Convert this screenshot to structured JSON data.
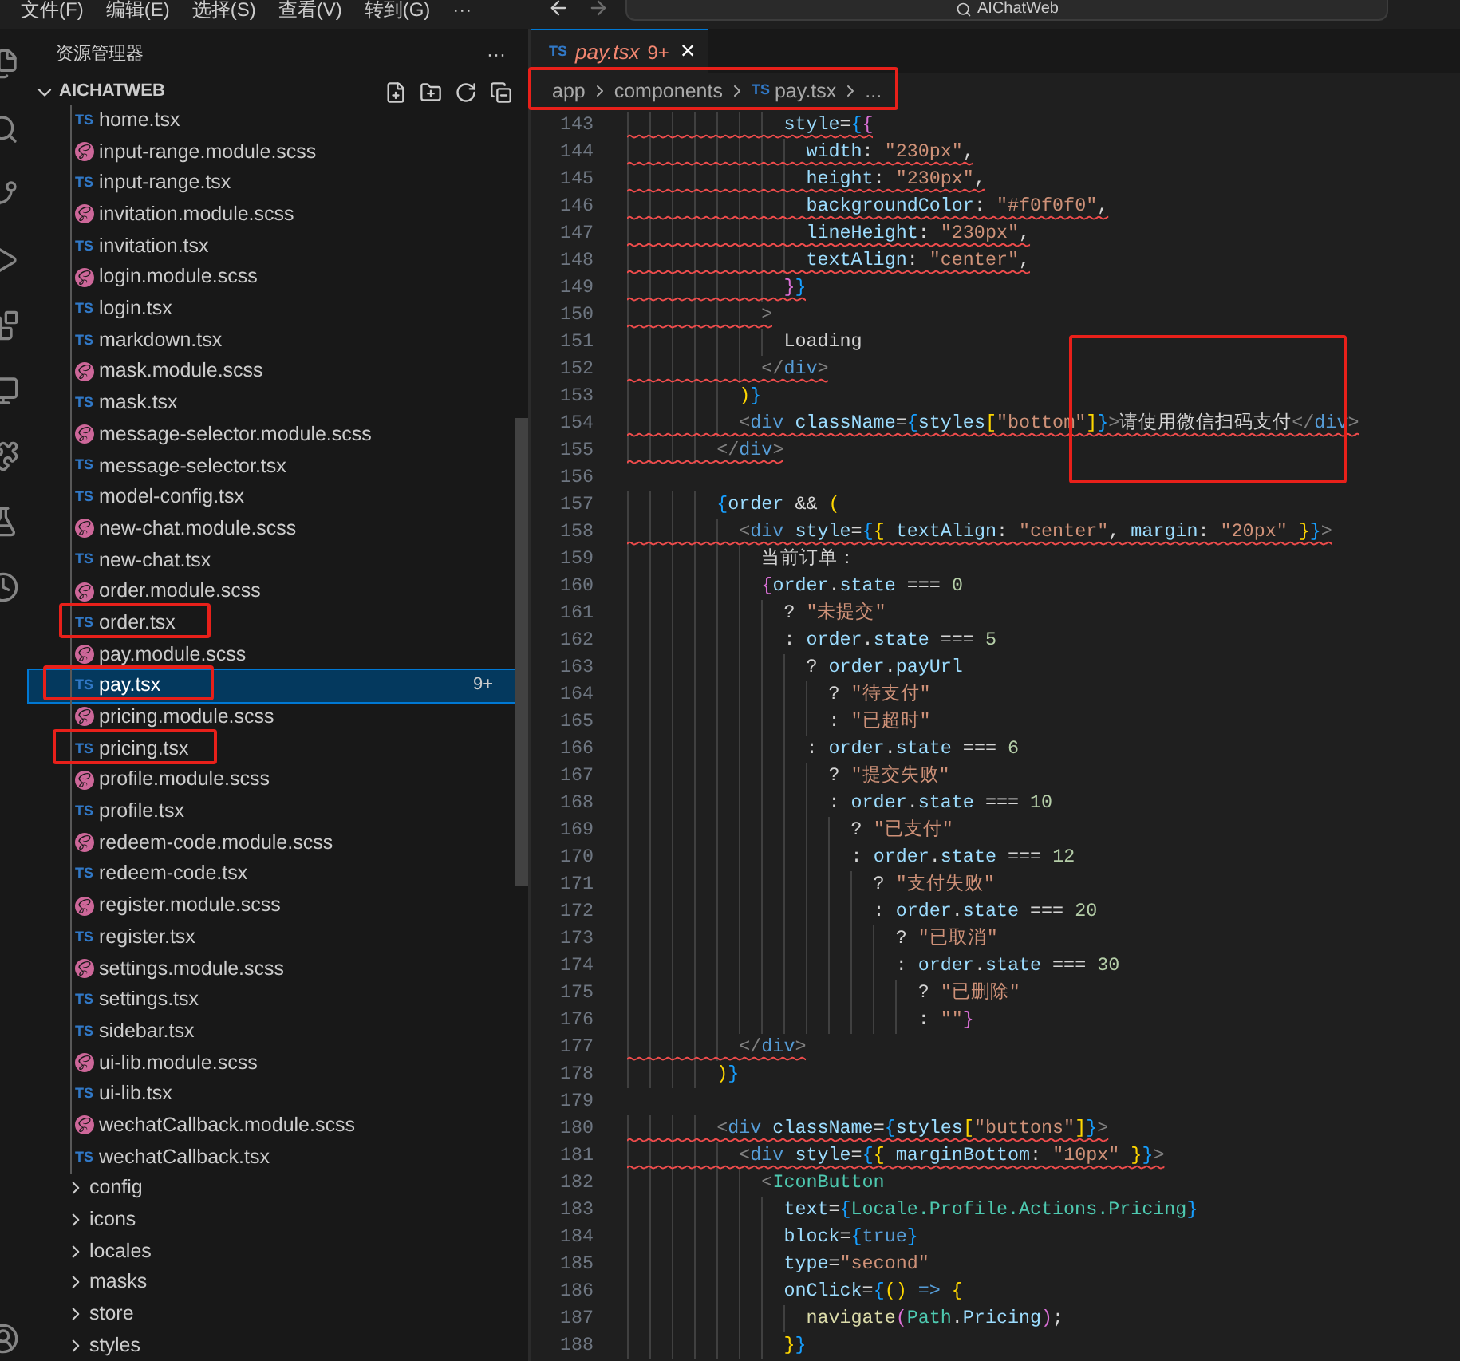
{
  "menu": [
    "文件(F)",
    "编辑(E)",
    "选择(S)",
    "查看(V)",
    "转到(G)",
    "···"
  ],
  "search": {
    "value": "AIChatWeb"
  },
  "explorer": {
    "title": "资源管理器",
    "more": "···",
    "root": "AICHATWEB",
    "expanded": true,
    "items": [
      {
        "kind": "ts",
        "icon": "TS",
        "name": "home.tsx",
        "selected": false
      },
      {
        "kind": "scss",
        "name": "input-range.module.scss",
        "selected": false
      },
      {
        "kind": "ts",
        "icon": "TS",
        "name": "input-range.tsx",
        "selected": false
      },
      {
        "kind": "scss",
        "name": "invitation.module.scss",
        "selected": false
      },
      {
        "kind": "ts",
        "icon": "TS",
        "name": "invitation.tsx",
        "selected": false
      },
      {
        "kind": "scss",
        "name": "login.module.scss",
        "selected": false
      },
      {
        "kind": "ts",
        "icon": "TS",
        "name": "login.tsx",
        "selected": false
      },
      {
        "kind": "ts",
        "icon": "TS",
        "name": "markdown.tsx",
        "selected": false
      },
      {
        "kind": "scss",
        "name": "mask.module.scss",
        "selected": false
      },
      {
        "kind": "ts",
        "icon": "TS",
        "name": "mask.tsx",
        "selected": false
      },
      {
        "kind": "scss",
        "name": "message-selector.module.scss",
        "selected": false
      },
      {
        "kind": "ts",
        "icon": "TS",
        "name": "message-selector.tsx",
        "selected": false
      },
      {
        "kind": "ts",
        "icon": "TS",
        "name": "model-config.tsx",
        "selected": false
      },
      {
        "kind": "scss",
        "name": "new-chat.module.scss",
        "selected": false
      },
      {
        "kind": "ts",
        "icon": "TS",
        "name": "new-chat.tsx",
        "selected": false
      },
      {
        "kind": "scss",
        "name": "order.module.scss",
        "selected": false
      },
      {
        "kind": "ts",
        "icon": "TS",
        "name": "order.tsx",
        "selected": false
      },
      {
        "kind": "scss",
        "name": "pay.module.scss",
        "selected": false
      },
      {
        "kind": "ts",
        "icon": "TS",
        "name": "pay.tsx",
        "selected": true,
        "badge": "9+"
      },
      {
        "kind": "scss",
        "name": "pricing.module.scss",
        "selected": false
      },
      {
        "kind": "ts",
        "icon": "TS",
        "name": "pricing.tsx",
        "selected": false
      },
      {
        "kind": "scss",
        "name": "profile.module.scss",
        "selected": false
      },
      {
        "kind": "ts",
        "icon": "TS",
        "name": "profile.tsx",
        "selected": false
      },
      {
        "kind": "scss",
        "name": "redeem-code.module.scss",
        "selected": false
      },
      {
        "kind": "ts",
        "icon": "TS",
        "name": "redeem-code.tsx",
        "selected": false
      },
      {
        "kind": "scss",
        "name": "register.module.scss",
        "selected": false
      },
      {
        "kind": "ts",
        "icon": "TS",
        "name": "register.tsx",
        "selected": false
      },
      {
        "kind": "scss",
        "name": "settings.module.scss",
        "selected": false
      },
      {
        "kind": "ts",
        "icon": "TS",
        "name": "settings.tsx",
        "selected": false
      },
      {
        "kind": "ts",
        "icon": "TS",
        "name": "sidebar.tsx",
        "selected": false
      },
      {
        "kind": "scss",
        "name": "ui-lib.module.scss",
        "selected": false
      },
      {
        "kind": "ts",
        "icon": "TS",
        "name": "ui-lib.tsx",
        "selected": false
      },
      {
        "kind": "scss",
        "name": "wechatCallback.module.scss",
        "selected": false
      },
      {
        "kind": "ts",
        "icon": "TS",
        "name": "wechatCallback.tsx",
        "selected": false
      },
      {
        "kind": "folder",
        "name": "config",
        "selected": false,
        "expanded": false
      },
      {
        "kind": "folder",
        "name": "icons",
        "selected": false,
        "expanded": false
      },
      {
        "kind": "folder",
        "name": "locales",
        "selected": false,
        "expanded": false
      },
      {
        "kind": "folder",
        "name": "masks",
        "selected": false,
        "expanded": false
      },
      {
        "kind": "folder",
        "name": "store",
        "selected": false,
        "expanded": false
      },
      {
        "kind": "folder",
        "name": "styles",
        "selected": false,
        "expanded": false
      }
    ]
  },
  "tab": {
    "icon": "TS",
    "name": "pay.tsx",
    "problems": "9+",
    "has_errors": true,
    "selected": true,
    "close": "×"
  },
  "breadcrumb": [
    {
      "text": "app"
    },
    {
      "text": "components"
    },
    {
      "text": "pay.tsx",
      "icon": "TS"
    },
    {
      "text": "..."
    }
  ],
  "code": [
    {
      "n": "143",
      "error": true,
      "tokens": [
        {
          "text": "              style",
          "kind": "attr"
        },
        {
          "text": "=",
          "kind": "plain"
        },
        {
          "text": "{",
          "kind": "brace3"
        },
        {
          "text": "{",
          "kind": "brace2"
        }
      ]
    },
    {
      "n": "144",
      "error": true,
      "tokens": [
        {
          "text": "                width",
          "kind": "var"
        },
        {
          "text": ": ",
          "kind": "plain"
        },
        {
          "text": "\"230px\"",
          "kind": "string"
        },
        {
          "text": ",",
          "kind": "plain"
        }
      ]
    },
    {
      "n": "145",
      "error": true,
      "tokens": [
        {
          "text": "                height",
          "kind": "var"
        },
        {
          "text": ": ",
          "kind": "plain"
        },
        {
          "text": "\"230px\"",
          "kind": "string"
        },
        {
          "text": ",",
          "kind": "plain"
        }
      ]
    },
    {
      "n": "146",
      "error": true,
      "tokens": [
        {
          "text": "                backgroundColor",
          "kind": "var"
        },
        {
          "text": ": ",
          "kind": "plain"
        },
        {
          "text": "\"#f0f0f0\"",
          "kind": "string"
        },
        {
          "text": ",",
          "kind": "plain"
        }
      ]
    },
    {
      "n": "147",
      "error": true,
      "tokens": [
        {
          "text": "                lineHeight",
          "kind": "var"
        },
        {
          "text": ": ",
          "kind": "plain"
        },
        {
          "text": "\"230px\"",
          "kind": "string"
        },
        {
          "text": ",",
          "kind": "plain"
        }
      ]
    },
    {
      "n": "148",
      "error": true,
      "tokens": [
        {
          "text": "                textAlign",
          "kind": "var"
        },
        {
          "text": ": ",
          "kind": "plain"
        },
        {
          "text": "\"center\"",
          "kind": "string"
        },
        {
          "text": ",",
          "kind": "plain"
        }
      ]
    },
    {
      "n": "149",
      "error": true,
      "tokens": [
        {
          "text": "              }",
          "kind": "brace2"
        },
        {
          "text": "}",
          "kind": "brace3"
        }
      ]
    },
    {
      "n": "150",
      "error": true,
      "tokens": [
        {
          "text": "            >",
          "kind": "punct"
        }
      ]
    },
    {
      "n": "151",
      "error": false,
      "tokens": [
        {
          "text": "              Loading",
          "kind": "plain"
        }
      ]
    },
    {
      "n": "152",
      "error": true,
      "tokens": [
        {
          "text": "            </",
          "kind": "punct"
        },
        {
          "text": "div",
          "kind": "tag"
        },
        {
          "text": ">",
          "kind": "punct"
        }
      ]
    },
    {
      "n": "153",
      "error": false,
      "tokens": [
        {
          "text": "          )",
          "kind": "brace1"
        },
        {
          "text": "}",
          "kind": "brace3"
        }
      ]
    },
    {
      "n": "154",
      "error": true,
      "tokens": [
        {
          "text": "          <",
          "kind": "punct"
        },
        {
          "text": "div",
          "kind": "tag"
        },
        {
          "text": " className",
          "kind": "attr"
        },
        {
          "text": "=",
          "kind": "plain"
        },
        {
          "text": "{",
          "kind": "brace3"
        },
        {
          "text": "styles",
          "kind": "var"
        },
        {
          "text": "[",
          "kind": "brace1"
        },
        {
          "text": "\"bottom\"",
          "kind": "string"
        },
        {
          "text": "]",
          "kind": "brace1"
        },
        {
          "text": "}",
          "kind": "brace3"
        },
        {
          "text": ">",
          "kind": "punct"
        },
        {
          "text": "请使用微信扫码支付",
          "kind": "plain"
        },
        {
          "text": "</",
          "kind": "punct"
        },
        {
          "text": "div",
          "kind": "tag"
        },
        {
          "text": ">",
          "kind": "punct"
        }
      ]
    },
    {
      "n": "155",
      "error": true,
      "tokens": [
        {
          "text": "        </",
          "kind": "punct"
        },
        {
          "text": "div",
          "kind": "tag"
        },
        {
          "text": ">",
          "kind": "punct"
        }
      ]
    },
    {
      "n": "156"
    },
    {
      "n": "157",
      "error": false,
      "tokens": [
        {
          "text": "        {",
          "kind": "brace3"
        },
        {
          "text": "order",
          "kind": "var"
        },
        {
          "text": " && ",
          "kind": "plain"
        },
        {
          "text": "(",
          "kind": "brace1"
        }
      ]
    },
    {
      "n": "158",
      "error": true,
      "tokens": [
        {
          "text": "          <",
          "kind": "punct"
        },
        {
          "text": "div",
          "kind": "tag"
        },
        {
          "text": " style",
          "kind": "attr"
        },
        {
          "text": "=",
          "kind": "plain"
        },
        {
          "text": "{",
          "kind": "brace3"
        },
        {
          "text": "{ ",
          "kind": "brace1"
        },
        {
          "text": "textAlign",
          "kind": "var"
        },
        {
          "text": ": ",
          "kind": "plain"
        },
        {
          "text": "\"center\"",
          "kind": "string"
        },
        {
          "text": ", ",
          "kind": "plain"
        },
        {
          "text": "margin",
          "kind": "var"
        },
        {
          "text": ": ",
          "kind": "plain"
        },
        {
          "text": "\"20px\"",
          "kind": "string"
        },
        {
          "text": " }",
          "kind": "brace1"
        },
        {
          "text": "}",
          "kind": "brace3"
        },
        {
          "text": ">",
          "kind": "punct"
        }
      ]
    },
    {
      "n": "159",
      "error": false,
      "tokens": [
        {
          "text": "            当前订单：",
          "kind": "plain"
        }
      ]
    },
    {
      "n": "160",
      "error": false,
      "tokens": [
        {
          "text": "            {",
          "kind": "brace2"
        },
        {
          "text": "order",
          "kind": "var"
        },
        {
          "text": ".",
          "kind": "plain"
        },
        {
          "text": "state",
          "kind": "var"
        },
        {
          "text": " === ",
          "kind": "plain"
        },
        {
          "text": "0",
          "kind": "num"
        }
      ]
    },
    {
      "n": "161",
      "error": false,
      "tokens": [
        {
          "text": "              ? ",
          "kind": "plain"
        },
        {
          "text": "\"未提交\"",
          "kind": "string"
        }
      ]
    },
    {
      "n": "162",
      "error": false,
      "tokens": [
        {
          "text": "              : ",
          "kind": "plain"
        },
        {
          "text": "order",
          "kind": "var"
        },
        {
          "text": ".",
          "kind": "plain"
        },
        {
          "text": "state",
          "kind": "var"
        },
        {
          "text": " === ",
          "kind": "plain"
        },
        {
          "text": "5",
          "kind": "num"
        }
      ]
    },
    {
      "n": "163",
      "error": false,
      "tokens": [
        {
          "text": "                ? ",
          "kind": "plain"
        },
        {
          "text": "order",
          "kind": "var"
        },
        {
          "text": ".",
          "kind": "plain"
        },
        {
          "text": "payUrl",
          "kind": "var"
        }
      ]
    },
    {
      "n": "164",
      "error": false,
      "tokens": [
        {
          "text": "                  ? ",
          "kind": "plain"
        },
        {
          "text": "\"待支付\"",
          "kind": "string"
        }
      ]
    },
    {
      "n": "165",
      "error": false,
      "tokens": [
        {
          "text": "                  : ",
          "kind": "plain"
        },
        {
          "text": "\"已超时\"",
          "kind": "string"
        }
      ]
    },
    {
      "n": "166",
      "error": false,
      "tokens": [
        {
          "text": "                : ",
          "kind": "plain"
        },
        {
          "text": "order",
          "kind": "var"
        },
        {
          "text": ".",
          "kind": "plain"
        },
        {
          "text": "state",
          "kind": "var"
        },
        {
          "text": " === ",
          "kind": "plain"
        },
        {
          "text": "6",
          "kind": "num"
        }
      ]
    },
    {
      "n": "167",
      "error": false,
      "tokens": [
        {
          "text": "                  ? ",
          "kind": "plain"
        },
        {
          "text": "\"提交失败\"",
          "kind": "string"
        }
      ]
    },
    {
      "n": "168",
      "error": false,
      "tokens": [
        {
          "text": "                  : ",
          "kind": "plain"
        },
        {
          "text": "order",
          "kind": "var"
        },
        {
          "text": ".",
          "kind": "plain"
        },
        {
          "text": "state",
          "kind": "var"
        },
        {
          "text": " === ",
          "kind": "plain"
        },
        {
          "text": "10",
          "kind": "num"
        }
      ]
    },
    {
      "n": "169",
      "error": false,
      "tokens": [
        {
          "text": "                    ? ",
          "kind": "plain"
        },
        {
          "text": "\"已支付\"",
          "kind": "string"
        }
      ]
    },
    {
      "n": "170",
      "error": false,
      "tokens": [
        {
          "text": "                    : ",
          "kind": "plain"
        },
        {
          "text": "order",
          "kind": "var"
        },
        {
          "text": ".",
          "kind": "plain"
        },
        {
          "text": "state",
          "kind": "var"
        },
        {
          "text": " === ",
          "kind": "plain"
        },
        {
          "text": "12",
          "kind": "num"
        }
      ]
    },
    {
      "n": "171",
      "error": false,
      "tokens": [
        {
          "text": "                      ? ",
          "kind": "plain"
        },
        {
          "text": "\"支付失败\"",
          "kind": "string"
        }
      ]
    },
    {
      "n": "172",
      "error": false,
      "tokens": [
        {
          "text": "                      : ",
          "kind": "plain"
        },
        {
          "text": "order",
          "kind": "var"
        },
        {
          "text": ".",
          "kind": "plain"
        },
        {
          "text": "state",
          "kind": "var"
        },
        {
          "text": " === ",
          "kind": "plain"
        },
        {
          "text": "20",
          "kind": "num"
        }
      ]
    },
    {
      "n": "173",
      "error": false,
      "tokens": [
        {
          "text": "                        ? ",
          "kind": "plain"
        },
        {
          "text": "\"已取消\"",
          "kind": "string"
        }
      ]
    },
    {
      "n": "174",
      "error": false,
      "tokens": [
        {
          "text": "                        : ",
          "kind": "plain"
        },
        {
          "text": "order",
          "kind": "var"
        },
        {
          "text": ".",
          "kind": "plain"
        },
        {
          "text": "state",
          "kind": "var"
        },
        {
          "text": " === ",
          "kind": "plain"
        },
        {
          "text": "30",
          "kind": "num"
        }
      ]
    },
    {
      "n": "175",
      "error": false,
      "tokens": [
        {
          "text": "                          ? ",
          "kind": "plain"
        },
        {
          "text": "\"已删除\"",
          "kind": "string"
        }
      ]
    },
    {
      "n": "176",
      "error": false,
      "tokens": [
        {
          "text": "                          : ",
          "kind": "plain"
        },
        {
          "text": "\"\"",
          "kind": "string"
        },
        {
          "text": "}",
          "kind": "brace2"
        }
      ]
    },
    {
      "n": "177",
      "error": true,
      "tokens": [
        {
          "text": "          </",
          "kind": "punct"
        },
        {
          "text": "div",
          "kind": "tag"
        },
        {
          "text": ">",
          "kind": "punct"
        }
      ]
    },
    {
      "n": "178",
      "error": false,
      "tokens": [
        {
          "text": "        )",
          "kind": "brace1"
        },
        {
          "text": "}",
          "kind": "brace3"
        }
      ]
    },
    {
      "n": "179"
    },
    {
      "n": "180",
      "error": true,
      "tokens": [
        {
          "text": "        <",
          "kind": "punct"
        },
        {
          "text": "div",
          "kind": "tag"
        },
        {
          "text": " className",
          "kind": "attr"
        },
        {
          "text": "=",
          "kind": "plain"
        },
        {
          "text": "{",
          "kind": "brace3"
        },
        {
          "text": "styles",
          "kind": "var"
        },
        {
          "text": "[",
          "kind": "brace1"
        },
        {
          "text": "\"buttons\"",
          "kind": "string"
        },
        {
          "text": "]",
          "kind": "brace1"
        },
        {
          "text": "}",
          "kind": "brace3"
        },
        {
          "text": ">",
          "kind": "punct"
        }
      ]
    },
    {
      "n": "181",
      "error": true,
      "tokens": [
        {
          "text": "          <",
          "kind": "punct"
        },
        {
          "text": "div",
          "kind": "tag"
        },
        {
          "text": " style",
          "kind": "attr"
        },
        {
          "text": "=",
          "kind": "plain"
        },
        {
          "text": "{",
          "kind": "brace3"
        },
        {
          "text": "{ ",
          "kind": "brace1"
        },
        {
          "text": "marginBottom",
          "kind": "var"
        },
        {
          "text": ": ",
          "kind": "plain"
        },
        {
          "text": "\"10px\"",
          "kind": "string"
        },
        {
          "text": " }",
          "kind": "brace1"
        },
        {
          "text": "}",
          "kind": "brace3"
        },
        {
          "text": ">",
          "kind": "punct"
        }
      ]
    },
    {
      "n": "182",
      "error": false,
      "tokens": [
        {
          "text": "            <",
          "kind": "punct"
        },
        {
          "text": "IconButton",
          "kind": "type"
        }
      ]
    },
    {
      "n": "183",
      "error": false,
      "tokens": [
        {
          "text": "              text",
          "kind": "attr"
        },
        {
          "text": "=",
          "kind": "plain"
        },
        {
          "text": "{",
          "kind": "brace3"
        },
        {
          "text": "Locale.Profile.Actions.Pricing",
          "kind": "type"
        },
        {
          "text": "}",
          "kind": "brace3"
        }
      ]
    },
    {
      "n": "184",
      "error": false,
      "tokens": [
        {
          "text": "              block",
          "kind": "attr"
        },
        {
          "text": "=",
          "kind": "plain"
        },
        {
          "text": "{",
          "kind": "brace3"
        },
        {
          "text": "true",
          "kind": "keyword"
        },
        {
          "text": "}",
          "kind": "brace3"
        }
      ]
    },
    {
      "n": "185",
      "error": false,
      "tokens": [
        {
          "text": "              type",
          "kind": "attr"
        },
        {
          "text": "=",
          "kind": "plain"
        },
        {
          "text": "\"second\"",
          "kind": "string"
        }
      ]
    },
    {
      "n": "186",
      "error": false,
      "tokens": [
        {
          "text": "              onClick",
          "kind": "attr"
        },
        {
          "text": "=",
          "kind": "plain"
        },
        {
          "text": "{",
          "kind": "brace3"
        },
        {
          "text": "()",
          "kind": "brace1"
        },
        {
          "text": " => ",
          "kind": "keyword"
        },
        {
          "text": "{",
          "kind": "brace1"
        }
      ]
    },
    {
      "n": "187",
      "error": false,
      "tokens": [
        {
          "text": "                navigate",
          "kind": "func"
        },
        {
          "text": "(",
          "kind": "brace2"
        },
        {
          "text": "Path",
          "kind": "type"
        },
        {
          "text": ".",
          "kind": "plain"
        },
        {
          "text": "Pricing",
          "kind": "var"
        },
        {
          "text": ")",
          "kind": "brace2"
        },
        {
          "text": ";",
          "kind": "plain"
        }
      ]
    },
    {
      "n": "188",
      "error": false,
      "tokens": [
        {
          "text": "              }",
          "kind": "brace1"
        },
        {
          "text": "}",
          "kind": "brace3"
        }
      ]
    }
  ]
}
